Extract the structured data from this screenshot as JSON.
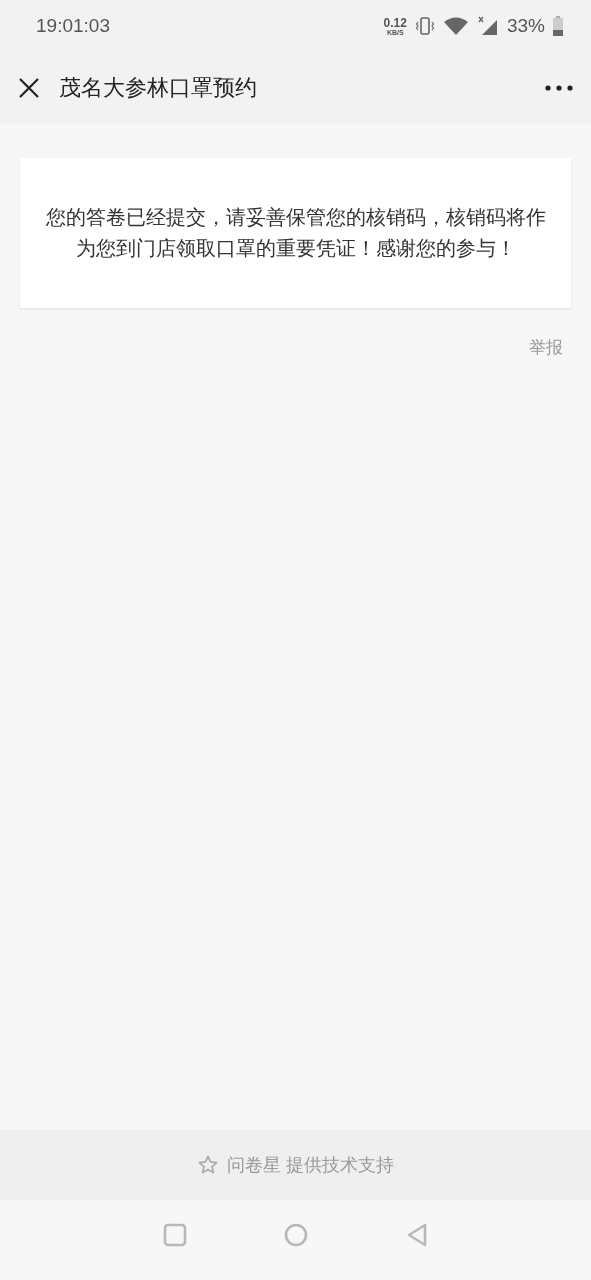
{
  "status_bar": {
    "time": "19:01:03",
    "net_speed": "0.12",
    "net_unit": "KB/S",
    "battery": "33%"
  },
  "header": {
    "title": "茂名大参林口罩预约"
  },
  "message": "您的答卷已经提交，请妥善保管您的核销码，核销码将作为您到门店领取口罩的重要凭证！感谢您的参与！",
  "report_link": "举报",
  "footer": {
    "text": "问卷星 提供技术支持"
  }
}
